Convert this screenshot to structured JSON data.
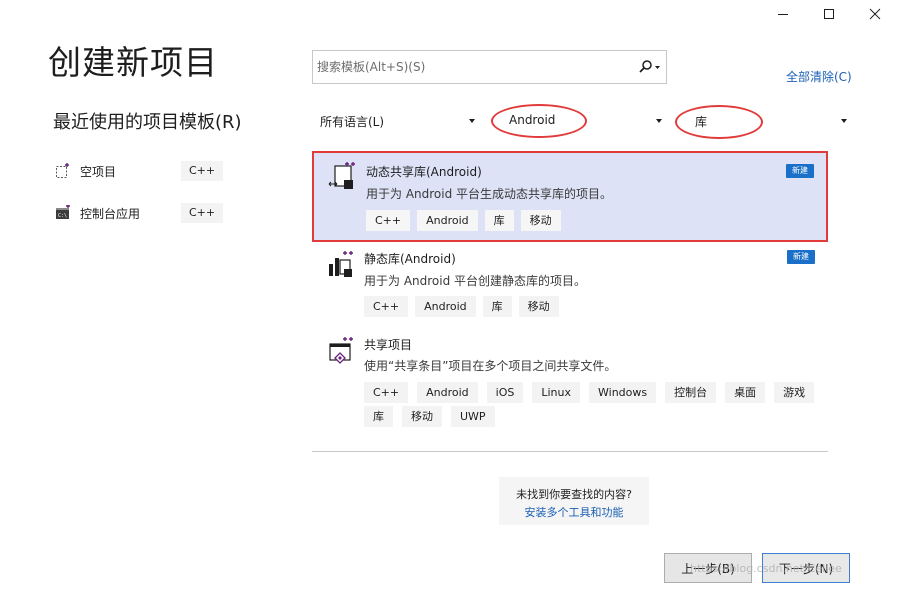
{
  "window": {
    "minimize_icon": "minimize-icon",
    "maximize_icon": "maximize-icon",
    "close_icon": "close-icon"
  },
  "page_title": "创建新项目",
  "recent": {
    "title": "最近使用的项目模板(R)",
    "items": [
      {
        "label": "空项目",
        "tag": "C++",
        "icon": "empty-project-icon"
      },
      {
        "label": "控制台应用",
        "tag": "C++",
        "icon": "console-app-icon"
      }
    ]
  },
  "search": {
    "placeholder": "搜索模板(Alt+S)(S)",
    "value": ""
  },
  "clear_all": "全部清除(C)",
  "filters": {
    "language": "所有语言(L)",
    "platform": "Android",
    "project_type": "库"
  },
  "templates": [
    {
      "name": "动态共享库(Android)",
      "desc": "用于为 Android 平台生成动态共享库的项目。",
      "badge": "新建",
      "tags": [
        "C++",
        "Android",
        "库",
        "移动"
      ],
      "selected": true
    },
    {
      "name": "静态库(Android)",
      "desc": "用于为 Android 平台创建静态库的项目。",
      "badge": "新建",
      "tags": [
        "C++",
        "Android",
        "库",
        "移动"
      ],
      "selected": false
    },
    {
      "name": "共享项目",
      "desc": "使用“共享条目”项目在多个项目之间共享文件。",
      "tags": [
        "C++",
        "Android",
        "iOS",
        "Linux",
        "Windows",
        "控制台",
        "桌面",
        "游戏",
        "库",
        "移动",
        "UWP"
      ],
      "selected": false
    }
  ],
  "not_found": {
    "question": "未找到你要查找的内容?",
    "link": "安装多个工具和功能"
  },
  "buttons": {
    "back": "上一步(B)",
    "next": "下一步(N)"
  },
  "watermark": "https://blog.csdn.net/Cellee",
  "colors": {
    "accent": "#1a70c8",
    "selected_bg": "#dee2f7",
    "highlight_red": "#e23b3b",
    "link": "#1a5fb4"
  }
}
